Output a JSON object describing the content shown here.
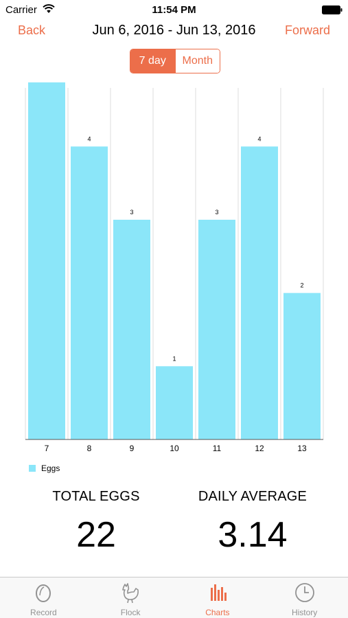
{
  "status_bar": {
    "carrier": "Carrier",
    "time": "11:54 PM"
  },
  "nav": {
    "back_label": "Back",
    "title": "Jun 6, 2016 - Jun 13, 2016",
    "forward_label": "Forward"
  },
  "segment": {
    "options": [
      "7 day",
      "Month"
    ],
    "selected": "7 day"
  },
  "colors": {
    "accent": "#ec6e4a",
    "bar": "#8be6f9",
    "grid": "#dcdcdc",
    "tab_inactive": "#929292"
  },
  "chart_data": {
    "type": "bar",
    "categories": [
      "7",
      "8",
      "9",
      "10",
      "11",
      "12",
      "13"
    ],
    "series": [
      {
        "name": "Eggs",
        "values": [
          5,
          4,
          3,
          1,
          3,
          4,
          2
        ]
      }
    ],
    "ylim": [
      0,
      4.8
    ],
    "grid": "vertical",
    "legend": "bottom-left"
  },
  "stats": {
    "total_label": "TOTAL EGGS",
    "total_value": "22",
    "average_label": "DAILY AVERAGE",
    "average_value": "3.14"
  },
  "tabs": [
    {
      "label": "Record",
      "icon": "egg-icon",
      "active": false
    },
    {
      "label": "Flock",
      "icon": "chicken-icon",
      "active": false
    },
    {
      "label": "Charts",
      "icon": "bar-chart-icon",
      "active": true
    },
    {
      "label": "History",
      "icon": "clock-icon",
      "active": false
    }
  ]
}
